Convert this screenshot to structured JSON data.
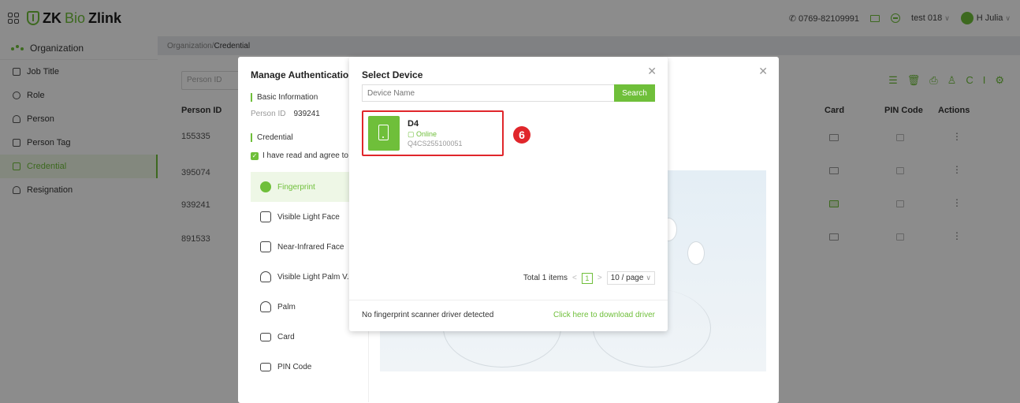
{
  "topbar": {
    "brand_zk": "ZK",
    "brand_bio": "Bio",
    "brand_zlink": " Zlink",
    "phone": "0769-82109991",
    "account": "test 018",
    "user": "H Julia"
  },
  "sidebar": {
    "header": "Organization",
    "items": [
      {
        "label": "Job Title"
      },
      {
        "label": "Role"
      },
      {
        "label": "Person"
      },
      {
        "label": "Person Tag"
      },
      {
        "label": "Credential"
      },
      {
        "label": "Resignation"
      }
    ]
  },
  "breadcrumb": {
    "root": "Organization",
    "sep": " / ",
    "current": "Credential"
  },
  "background": {
    "search_placeholder": "Person ID",
    "headers": {
      "person_id": "Person ID",
      "card": "Card",
      "pin": "PIN Code",
      "actions": "Actions"
    },
    "rows": [
      "155335",
      "395074",
      "939241",
      "891533"
    ]
  },
  "manage": {
    "title": "Manage Authentication",
    "basic_info": "Basic Information",
    "person_id_label": "Person ID",
    "person_id_value": "939241",
    "credential": "Credential",
    "agree": "I have read and agree to",
    "methods": [
      {
        "label": "Fingerprint"
      },
      {
        "label": "Visible Light Face"
      },
      {
        "label": "Near-Infrared Face"
      },
      {
        "label": "Visible Light Palm V..."
      },
      {
        "label": "Palm"
      },
      {
        "label": "Card"
      },
      {
        "label": "PIN Code"
      }
    ]
  },
  "select_device": {
    "title": "Select Device",
    "search_placeholder": "Device Name",
    "search_button": "Search",
    "device": {
      "name": "D4",
      "status": "Online",
      "serial": "Q4CS255100051"
    },
    "step_badge": "6",
    "total": "Total 1 items",
    "page": "1",
    "page_size": "10 / page",
    "no_driver": "No fingerprint scanner driver detected",
    "download": "Click here to download driver"
  },
  "colors": {
    "accent": "#6fbf3a",
    "highlight": "#e0262b"
  }
}
